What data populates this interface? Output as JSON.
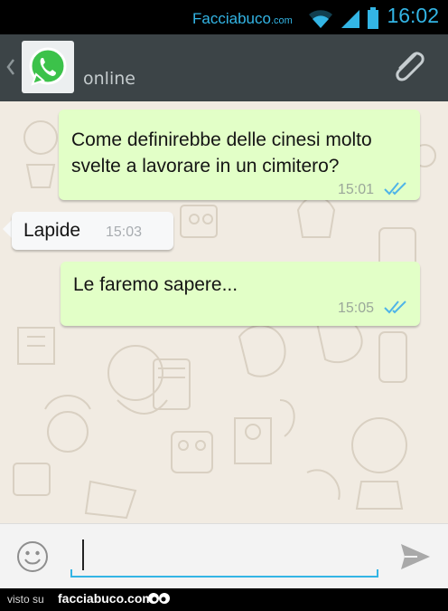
{
  "status_bar": {
    "watermark_main": "Facciabuco",
    "watermark_suffix": ".com",
    "time": "16:02",
    "icons": [
      "wifi-icon",
      "signal-icon",
      "battery-icon"
    ]
  },
  "header": {
    "contact_status": "online",
    "icons": [
      "chevron-left-icon",
      "whatsapp-icon",
      "paperclip-icon"
    ]
  },
  "messages": [
    {
      "direction": "outgoing",
      "text": "Come definirebbe delle cinesi molto svelte a lavorare in un cimitero?",
      "time": "15:01",
      "status": "read"
    },
    {
      "direction": "incoming",
      "text": "Lapide",
      "time": "15:03"
    },
    {
      "direction": "outgoing",
      "text": "Le faremo sapere...",
      "time": "15:05",
      "status": "read"
    }
  ],
  "compose": {
    "input_value": "",
    "icons": [
      "smiley-icon",
      "send-icon"
    ]
  },
  "footer": {
    "prefix": "visto su",
    "brand": "facciabuco.com"
  },
  "colors": {
    "status_accent": "#33b5e5",
    "action_bar": "#3c4447",
    "chat_background": "#f1ebe2",
    "outgoing_bubble": "#e2ffc7",
    "incoming_bubble": "#f7f8f9",
    "read_ticks": "#4fb4e8",
    "whatsapp_green": "#3cc24a"
  }
}
